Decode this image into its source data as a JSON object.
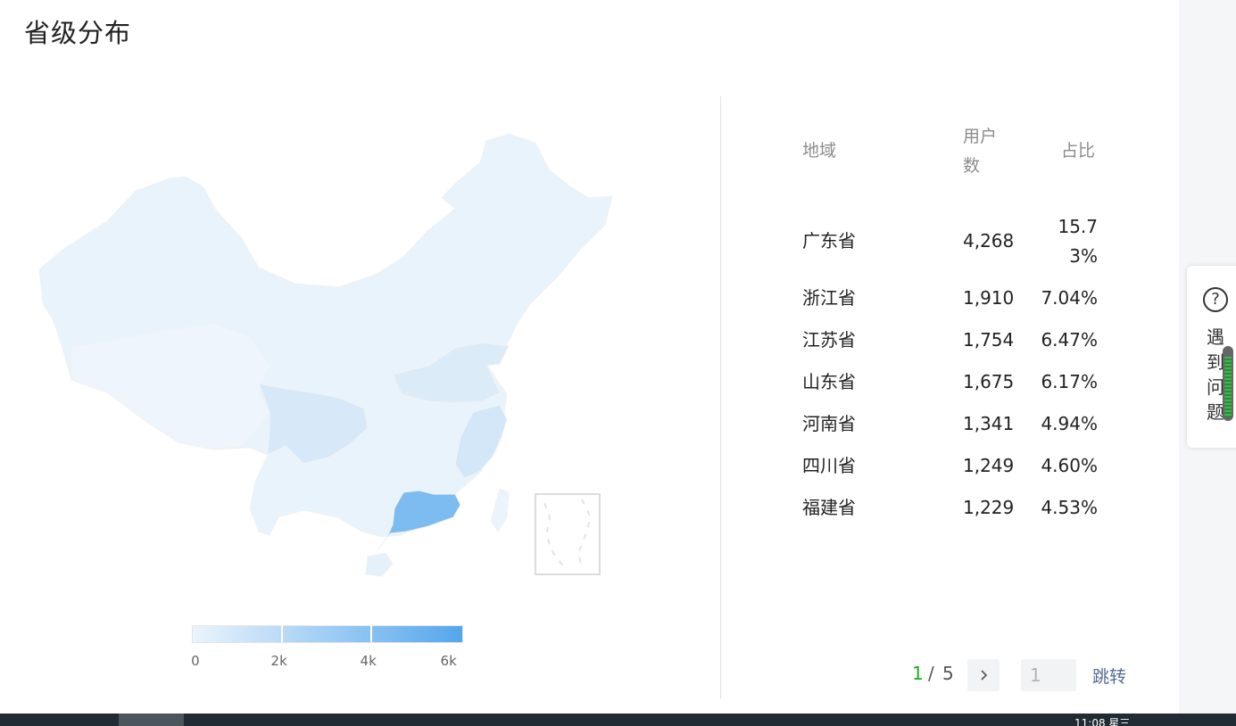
{
  "title": "省级分布",
  "legend": {
    "labels": [
      "0",
      "2k",
      "4k",
      "6k"
    ],
    "color_low": "#eaf4fc",
    "color_high": "#55a6ec"
  },
  "table": {
    "headers": {
      "region": "地域",
      "users_line1": "用户",
      "users_line2": "数",
      "ratio": "占比"
    },
    "rows": [
      {
        "region": "广东省",
        "users": "4,268",
        "ratio_line1": "15.7",
        "ratio_line2": "3%"
      },
      {
        "region": "浙江省",
        "users": "1,910",
        "ratio": "7.04%"
      },
      {
        "region": "江苏省",
        "users": "1,754",
        "ratio": "6.47%"
      },
      {
        "region": "山东省",
        "users": "1,675",
        "ratio": "6.17%"
      },
      {
        "region": "河南省",
        "users": "1,341",
        "ratio": "4.94%"
      },
      {
        "region": "四川省",
        "users": "1,249",
        "ratio": "4.60%"
      },
      {
        "region": "福建省",
        "users": "1,229",
        "ratio": "4.53%"
      }
    ]
  },
  "pagination": {
    "current": "1",
    "separator": "/",
    "total": "5",
    "next_icon": "chevron-right-icon",
    "input_placeholder": "1",
    "jump_label": "跳转",
    "current_color": "#1aad19"
  },
  "help": {
    "icon": "question-circle-icon",
    "text": "遇到问题"
  },
  "taskbar": {
    "clock": "11:08 星三"
  }
}
